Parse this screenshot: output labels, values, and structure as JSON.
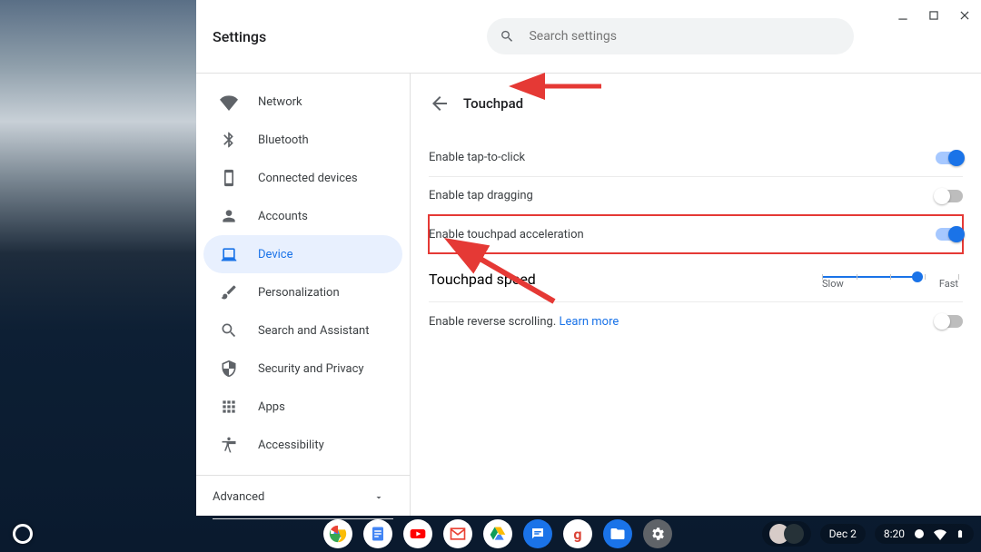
{
  "window": {
    "app_title": "Settings",
    "search_placeholder": "Search settings"
  },
  "sidebar": {
    "items": [
      {
        "id": "network",
        "label": "Network"
      },
      {
        "id": "bluetooth",
        "label": "Bluetooth"
      },
      {
        "id": "connected",
        "label": "Connected devices"
      },
      {
        "id": "accounts",
        "label": "Accounts"
      },
      {
        "id": "device",
        "label": "Device"
      },
      {
        "id": "personalization",
        "label": "Personalization"
      },
      {
        "id": "search",
        "label": "Search and Assistant"
      },
      {
        "id": "security",
        "label": "Security and Privacy"
      },
      {
        "id": "apps",
        "label": "Apps"
      },
      {
        "id": "accessibility",
        "label": "Accessibility"
      }
    ],
    "active_id": "device",
    "advanced_label": "Advanced"
  },
  "main": {
    "section_title": "Touchpad",
    "rows": {
      "tap_to_click": {
        "label": "Enable tap-to-click",
        "on": true
      },
      "tap_dragging": {
        "label": "Enable tap dragging",
        "on": false
      },
      "acceleration": {
        "label": "Enable touchpad acceleration",
        "on": true,
        "highlight": true
      },
      "speed": {
        "label": "Touchpad speed",
        "slow": "Slow",
        "fast": "Fast",
        "value_pct": 70
      },
      "reverse": {
        "label": "Enable reverse scrolling. ",
        "link": "Learn more",
        "on": false
      }
    }
  },
  "shelf": {
    "date": "Dec 2",
    "time": "8:20",
    "apps": [
      {
        "id": "chrome",
        "color": "#ea4335"
      },
      {
        "id": "docs",
        "color": "#4285f4"
      },
      {
        "id": "youtube",
        "color": "#ff0000"
      },
      {
        "id": "gmail",
        "color": "#ea4335"
      },
      {
        "id": "drive",
        "color": "#0f9d58"
      },
      {
        "id": "messages",
        "color": "#1a73e8"
      },
      {
        "id": "plus",
        "color": "#db4437"
      },
      {
        "id": "files",
        "color": "#1a73e8"
      },
      {
        "id": "settings",
        "color": "#5f6368"
      }
    ]
  }
}
